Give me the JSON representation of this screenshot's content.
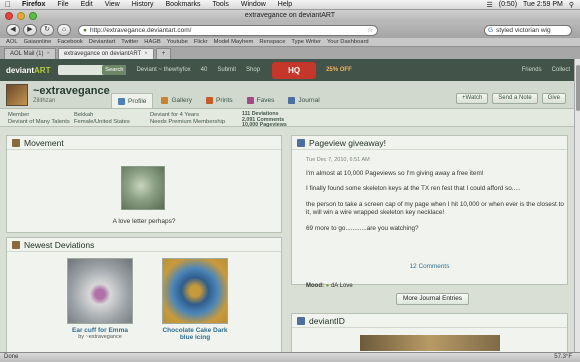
{
  "menubar": {
    "app": "Firefox",
    "items": [
      "File",
      "Edit",
      "View",
      "History",
      "Bookmarks",
      "Tools",
      "Window",
      "Help"
    ],
    "battery": "(0:50)",
    "day_time": "Tue 2:59 PM"
  },
  "window": {
    "title": "extravegance on deviantART"
  },
  "nav": {
    "url": "http://extravegance.deviantart.com/",
    "search_value": "styled victorian wig"
  },
  "bookmarks": [
    "AOL",
    "Gaiaonline",
    "Facebook",
    "Deviantart",
    "Twitter",
    "HAGB",
    "Youtube",
    "Flickr",
    "Model Mayhem",
    "Renspace",
    "Type Writer",
    "Your Dashboard"
  ],
  "tabs": [
    {
      "label": "AOL Mail (1)",
      "active": false
    },
    {
      "label": "extravegance on deviantART",
      "active": true
    }
  ],
  "da_header": {
    "logo_a": "deviant",
    "logo_b": "ART",
    "search_button": "Search",
    "user_link": "Deviant ~ thewhyfox",
    "message_count": "40",
    "submit": "Submit",
    "shop": "Shop",
    "promo": "HQ",
    "promo_sub": "Holiday",
    "promo_off": "25% OFF",
    "friends": "Friends",
    "collect": "Collect"
  },
  "profile": {
    "username": "~extravegance",
    "real_name": "Zilithzan",
    "tabs": [
      "Profile",
      "Gallery",
      "Prints",
      "Faves",
      "Journal"
    ],
    "watch_button": "+Watch",
    "note_button": "Send a Note",
    "give_button": "Give"
  },
  "info": {
    "member": "Member",
    "member_sub": "Deviant of Many Talents",
    "name": "Bekkah",
    "gender": "Female/United States",
    "deviant_for": "Deviant for 4 Years",
    "membership": "Needs Premium Membership",
    "deviations": "111 Deviations",
    "comments": "2,091 Comments",
    "pageviews": "10,000 Pageviews"
  },
  "movement": {
    "title": "Movement",
    "caption": "A love letter perhaps?"
  },
  "newest": {
    "title": "Newest Deviations",
    "items": [
      {
        "title": "Ear cuff for Emma",
        "by": "by ~extravegance"
      },
      {
        "title": "Chocolate Cake Dark blue icing",
        "by": ""
      }
    ]
  },
  "journal": {
    "title": "Pageview giveaway!",
    "date": "Tue Dec 7, 2010, 6:51 AM",
    "paragraphs": [
      "I'm almost at 10,000 Pageviews so I'm giving away a free item!",
      "I finally found some skeleton keys at the TX ren fest that I could afford so.....",
      "the person to take a screen cap of my page when I hit 10,000 or when ever is the closest to it, will win a wire wrapped skeleton key necklace!",
      "69 more to go............are you watching?"
    ],
    "comments": "12 Comments",
    "mood_label": "Mood:",
    "mood_value": "dA Love",
    "more_button": "More Journal Entries"
  },
  "deviantid": {
    "title": "deviantID"
  },
  "statusbar": {
    "left": "Done",
    "temp": "57.3°F"
  }
}
